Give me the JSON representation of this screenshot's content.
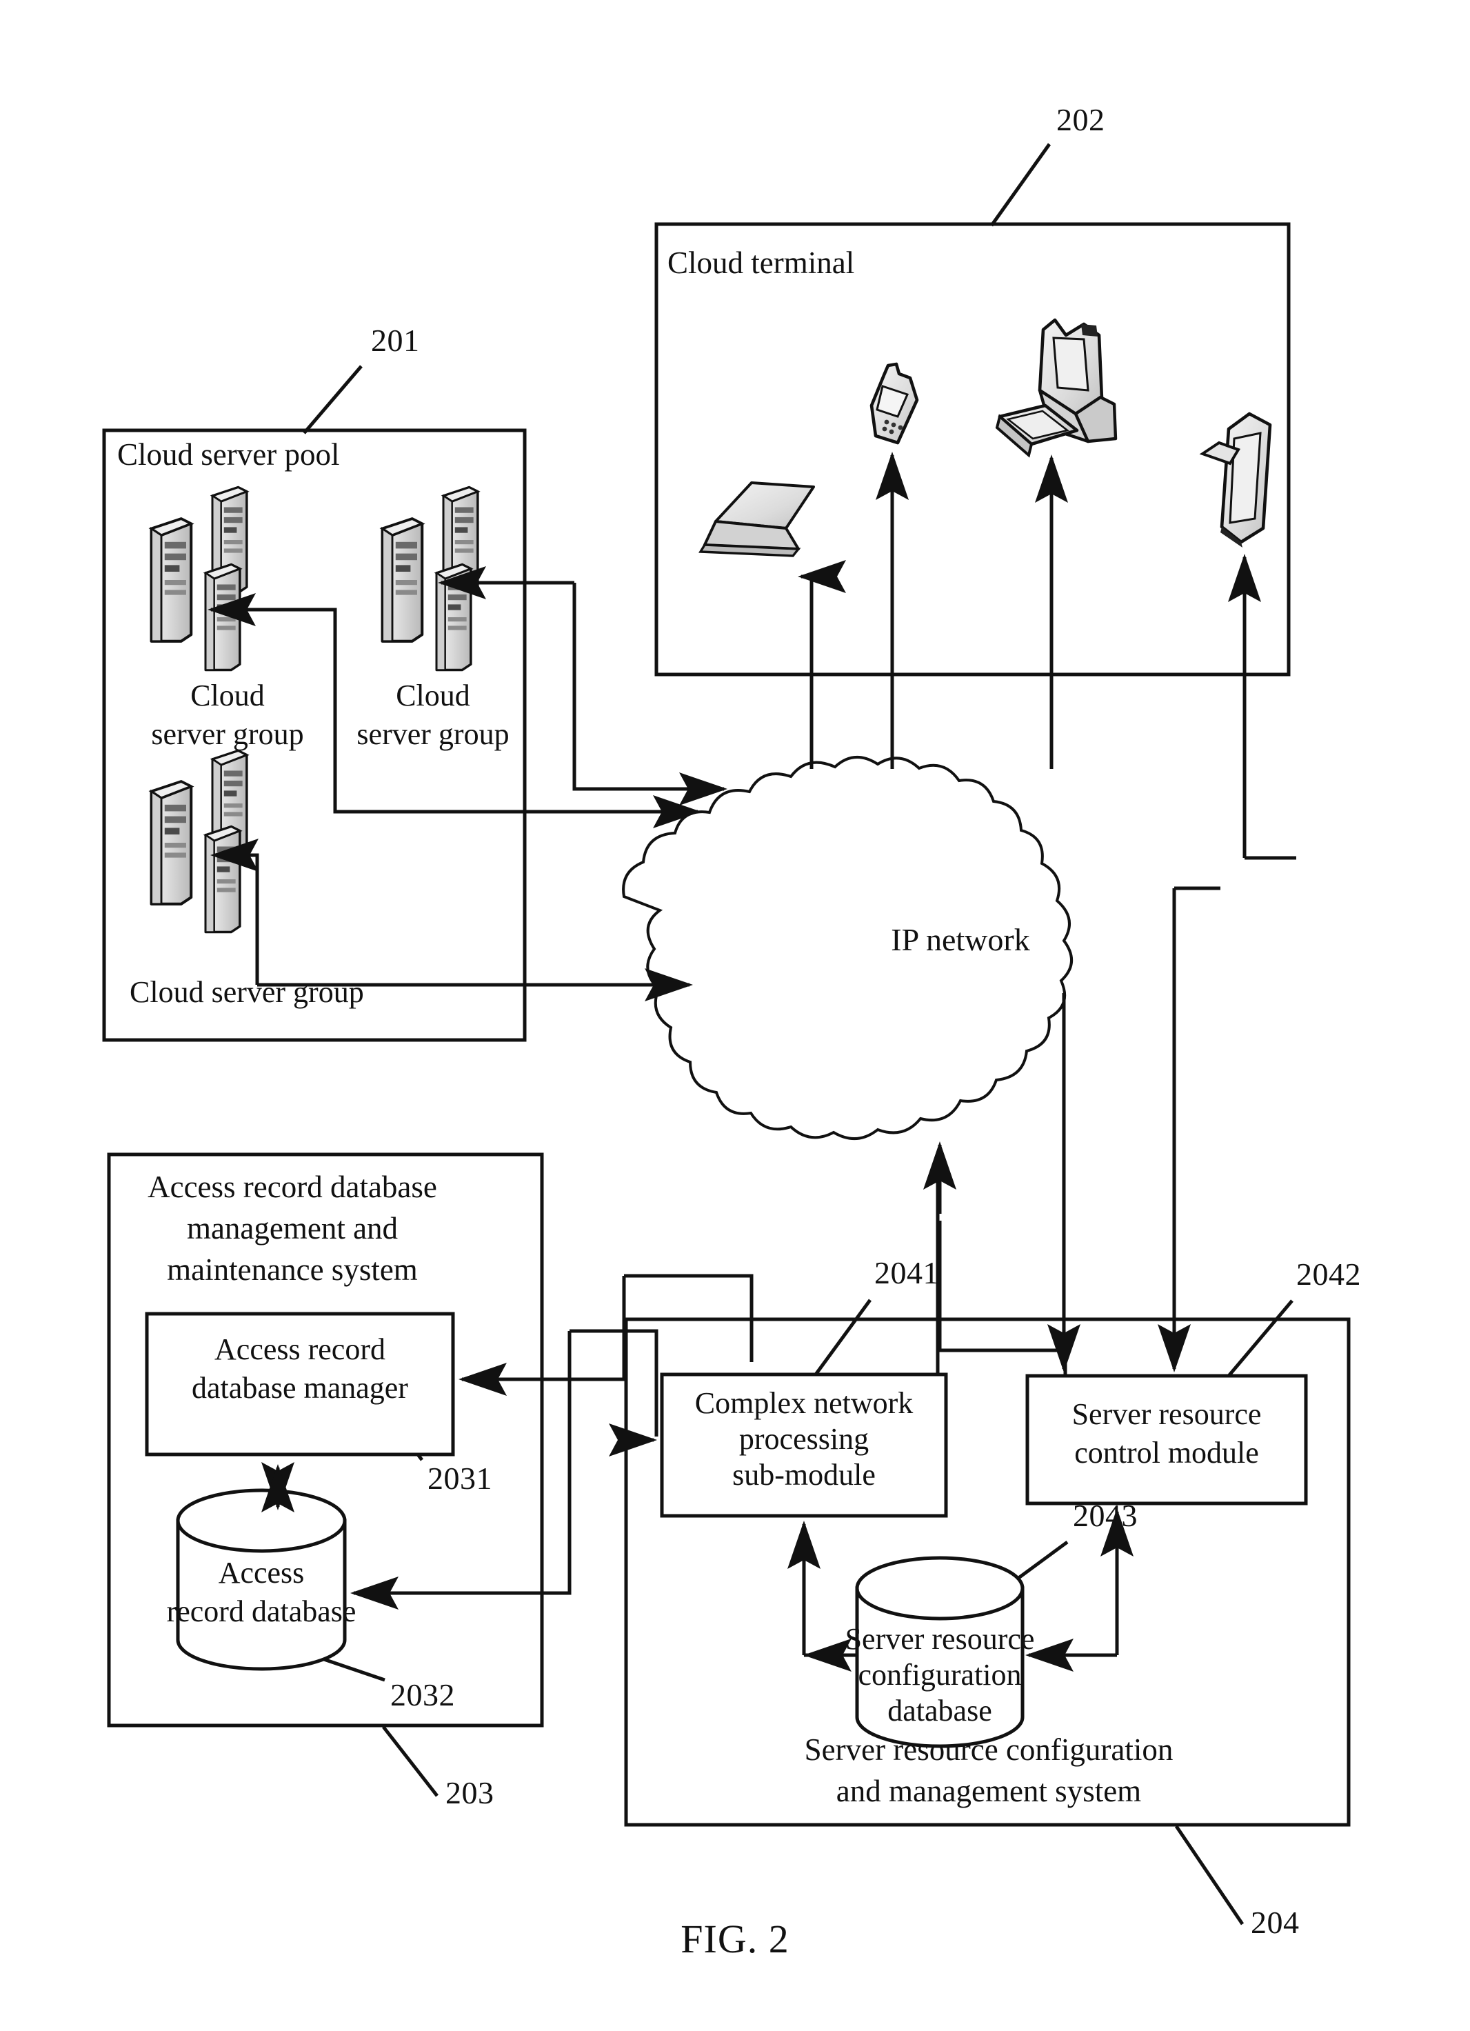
{
  "figure": {
    "caption": "FIG. 2",
    "domain_note": "patent drawing"
  },
  "containers": {
    "cloud_server_pool": {
      "label": "Cloud server pool",
      "ref": "201"
    },
    "cloud_terminal": {
      "label": "Cloud terminal",
      "ref": "202"
    },
    "access_record_system": {
      "label_line1": "Access record database",
      "label_line2": "management and",
      "label_line3": "maintenance system",
      "ref": "203"
    },
    "server_resource_system": {
      "label_line1": "Server resource configuration",
      "label_line2": "and management system",
      "ref": "204"
    }
  },
  "network": {
    "label": "IP network",
    "shape": "cloud"
  },
  "server_groups": [
    {
      "id": "group-top-left",
      "label_line1": "Cloud",
      "label_line2": "server group",
      "servers": 3
    },
    {
      "id": "group-top-right",
      "label_line1": "Cloud",
      "label_line2": "server group",
      "servers": 3
    },
    {
      "id": "group-bottom-left",
      "label_line1": "Cloud server group",
      "label_line2": "",
      "servers": 3
    }
  ],
  "terminals": [
    {
      "id": "laptop",
      "icon": "laptop-icon"
    },
    {
      "id": "mobile",
      "icon": "mobile-phone-icon"
    },
    {
      "id": "desktop",
      "icon": "desktop-computer-icon"
    },
    {
      "id": "tablet",
      "icon": "tablet-icon"
    }
  ],
  "nodes": {
    "access_record_database_manager": {
      "label_line1": "Access record",
      "label_line2": "database manager",
      "ref": "2031"
    },
    "access_record_database": {
      "label_line1": "Access",
      "label_line2": "record database",
      "ref": "2032",
      "shape": "cylinder"
    },
    "complex_network_processing_submodule": {
      "label_line1": "Complex network",
      "label_line2": "processing",
      "label_line3": "sub-module",
      "ref": "2041"
    },
    "server_resource_control_module": {
      "label_line1": "Server resource",
      "label_line2": "control module",
      "ref": "2042"
    },
    "server_resource_configuration_database": {
      "label_line1": "Server resource",
      "label_line2": "configuration",
      "label_line3": "database",
      "ref": "2043",
      "shape": "cylinder"
    }
  },
  "colors": {
    "ink": "#111111",
    "paper": "#ffffff",
    "server_fill": "#d8d8d8",
    "device_fill": "#e2e2e2"
  }
}
